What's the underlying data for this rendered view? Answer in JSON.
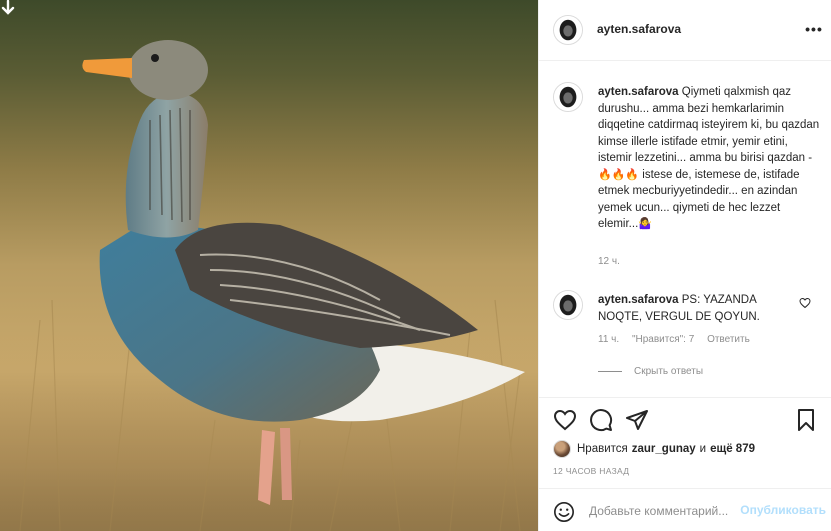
{
  "post": {
    "username": "ayten.safarova",
    "more_icon": "more-horizontal-icon",
    "photo_subject": "goose"
  },
  "caption": {
    "username": "ayten.safarova",
    "text_before_emoji": "Qiymeti qalxmish qaz durushu... amma bezi hemkarlarimin diqqetine catdirmaq isteyirem ki, bu qazdan kimse illerle istifade etmir, yemir etini, istemir lezzetini... amma bu birisi qazdan -",
    "emoji_fire": "🔥🔥🔥",
    "text_after_emoji": "istese de, istemese de, istifade etmek mecburiyyetindedir... en azindan yemek ucun... qiymeti de hec lezzet elemir...",
    "emoji_end": "🤷‍♀️",
    "time": "12 ч."
  },
  "reply": {
    "username": "ayten.safarova",
    "text": "PS: YAZANDA NOQTE, VERGUL DE QOYUN.",
    "time": "11 ч.",
    "likes_label": "\"Нравится\": 7",
    "reply_label": "Ответить",
    "hide_replies_label": "Скрыть ответы"
  },
  "actions": {
    "like_icon": "heart-icon",
    "comment_icon": "comment-icon",
    "share_icon": "share-icon",
    "save_icon": "bookmark-icon"
  },
  "likes": {
    "prefix": "Нравится",
    "user": "zaur_gunay",
    "conj": "и",
    "rest": "ещё 879"
  },
  "timestamp": "12 ЧАСОВ НАЗАД",
  "add_comment": {
    "placeholder": "Добавьте комментарий...",
    "publish_label": "Опубликовать"
  },
  "colors": {
    "text": "#262626",
    "muted": "#8e8e8e",
    "border": "#efefef",
    "publish_disabled": "#b2dffc"
  }
}
